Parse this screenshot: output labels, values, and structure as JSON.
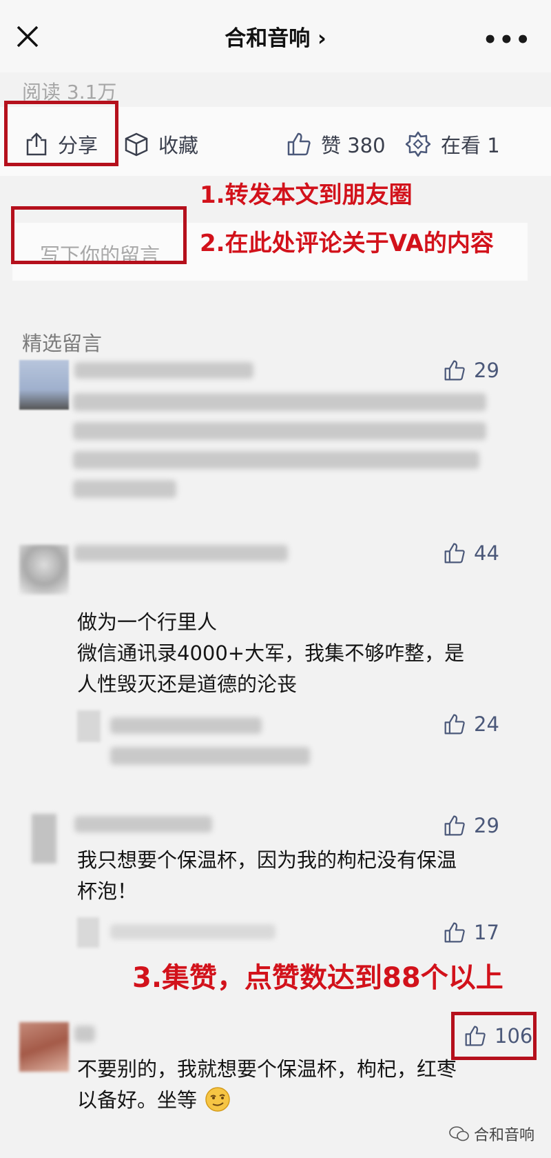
{
  "header": {
    "title": "合和音响 ›"
  },
  "read_count": "阅读 3.1万",
  "actions": {
    "share": "分享",
    "collect": "收藏",
    "like": "赞 380",
    "wow": "在看 1"
  },
  "annotations": {
    "step1": "1.转发本文到朋友圈",
    "step2": "2.在此处评论关于VA的内容",
    "step3": "3.集赞，点赞数达到88个以上"
  },
  "comment_input": {
    "placeholder": "写下你的留言"
  },
  "comments_section": {
    "title": "精选留言"
  },
  "comments": [
    {
      "likes": "29"
    },
    {
      "likes": "44",
      "text_lines": [
        "做为一个行里人",
        "微信通讯录4000+大军，我集不够咋整，是",
        "人性毁灭还是道德的沦丧"
      ]
    },
    {
      "likes": "24"
    },
    {
      "likes": "29",
      "text_lines": [
        "我只想要个保温杯，因为我的枸杞没有保温",
        "杯泡！"
      ]
    },
    {
      "likes": "17"
    },
    {
      "likes": "106",
      "text_lines": [
        "不要别的，我就想要个保温杯，枸杞，红枣",
        "以备好。坐等"
      ]
    }
  ],
  "watermark": "合和音响",
  "colors": {
    "annotation_red": "#d2121b",
    "box_red": "#b5101c",
    "like_blue": "#4b5879"
  }
}
